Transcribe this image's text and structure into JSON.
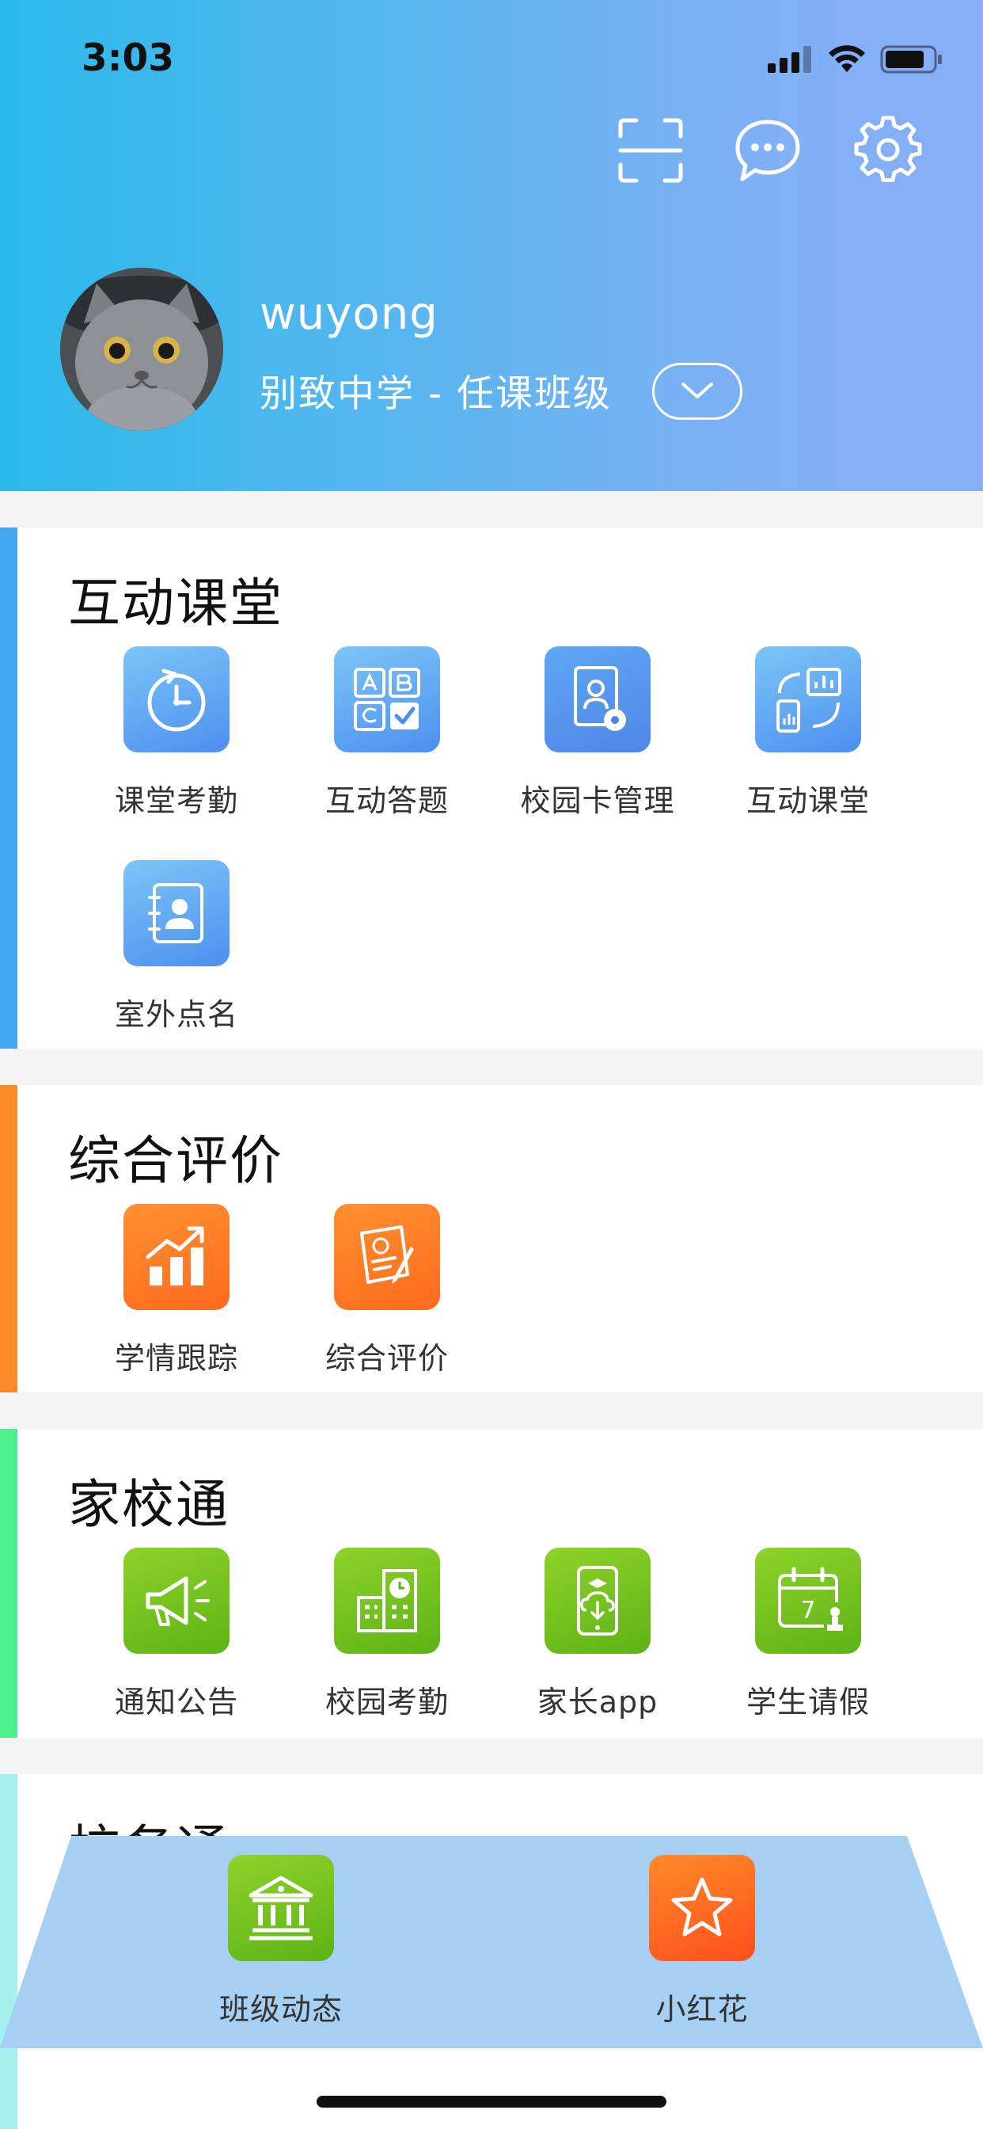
{
  "status_bar": {
    "time": "3:03"
  },
  "header": {
    "username": "wuyong",
    "school": "别致中学 - 任课班级",
    "icons": [
      "scan-icon",
      "message-icon",
      "settings-icon"
    ],
    "gradient_colors": [
      "#2bbaea",
      "#87aef6"
    ]
  },
  "sections": [
    {
      "title": "互动课堂",
      "accent": "#44a8f5",
      "items": [
        {
          "label": "课堂考勤",
          "icon": "clock-attendance-icon"
        },
        {
          "label": "互动答题",
          "icon": "abc-quiz-icon"
        },
        {
          "label": "校园卡管理",
          "icon": "card-settings-icon"
        },
        {
          "label": "互动课堂",
          "icon": "interactive-class-icon"
        },
        {
          "label": "室外点名",
          "icon": "contact-book-icon"
        }
      ]
    },
    {
      "title": "综合评价",
      "accent": "#ff8a2a",
      "items": [
        {
          "label": "学情跟踪",
          "icon": "growth-chart-icon"
        },
        {
          "label": "综合评价",
          "icon": "evaluation-paper-icon"
        }
      ]
    },
    {
      "title": "家校通",
      "accent": "#4df08a",
      "items": [
        {
          "label": "通知公告",
          "icon": "megaphone-icon"
        },
        {
          "label": "校园考勤",
          "icon": "building-clock-icon"
        },
        {
          "label": "家长app",
          "icon": "phone-download-icon"
        },
        {
          "label": "学生请假",
          "icon": "calendar-stamp-icon"
        }
      ]
    },
    {
      "title": "校务通",
      "accent": "#a8f0f0"
    }
  ],
  "floating_bar": {
    "items": [
      {
        "label": "班级动态",
        "icon": "institution-icon"
      },
      {
        "label": "小红花",
        "icon": "star-icon"
      }
    ]
  }
}
